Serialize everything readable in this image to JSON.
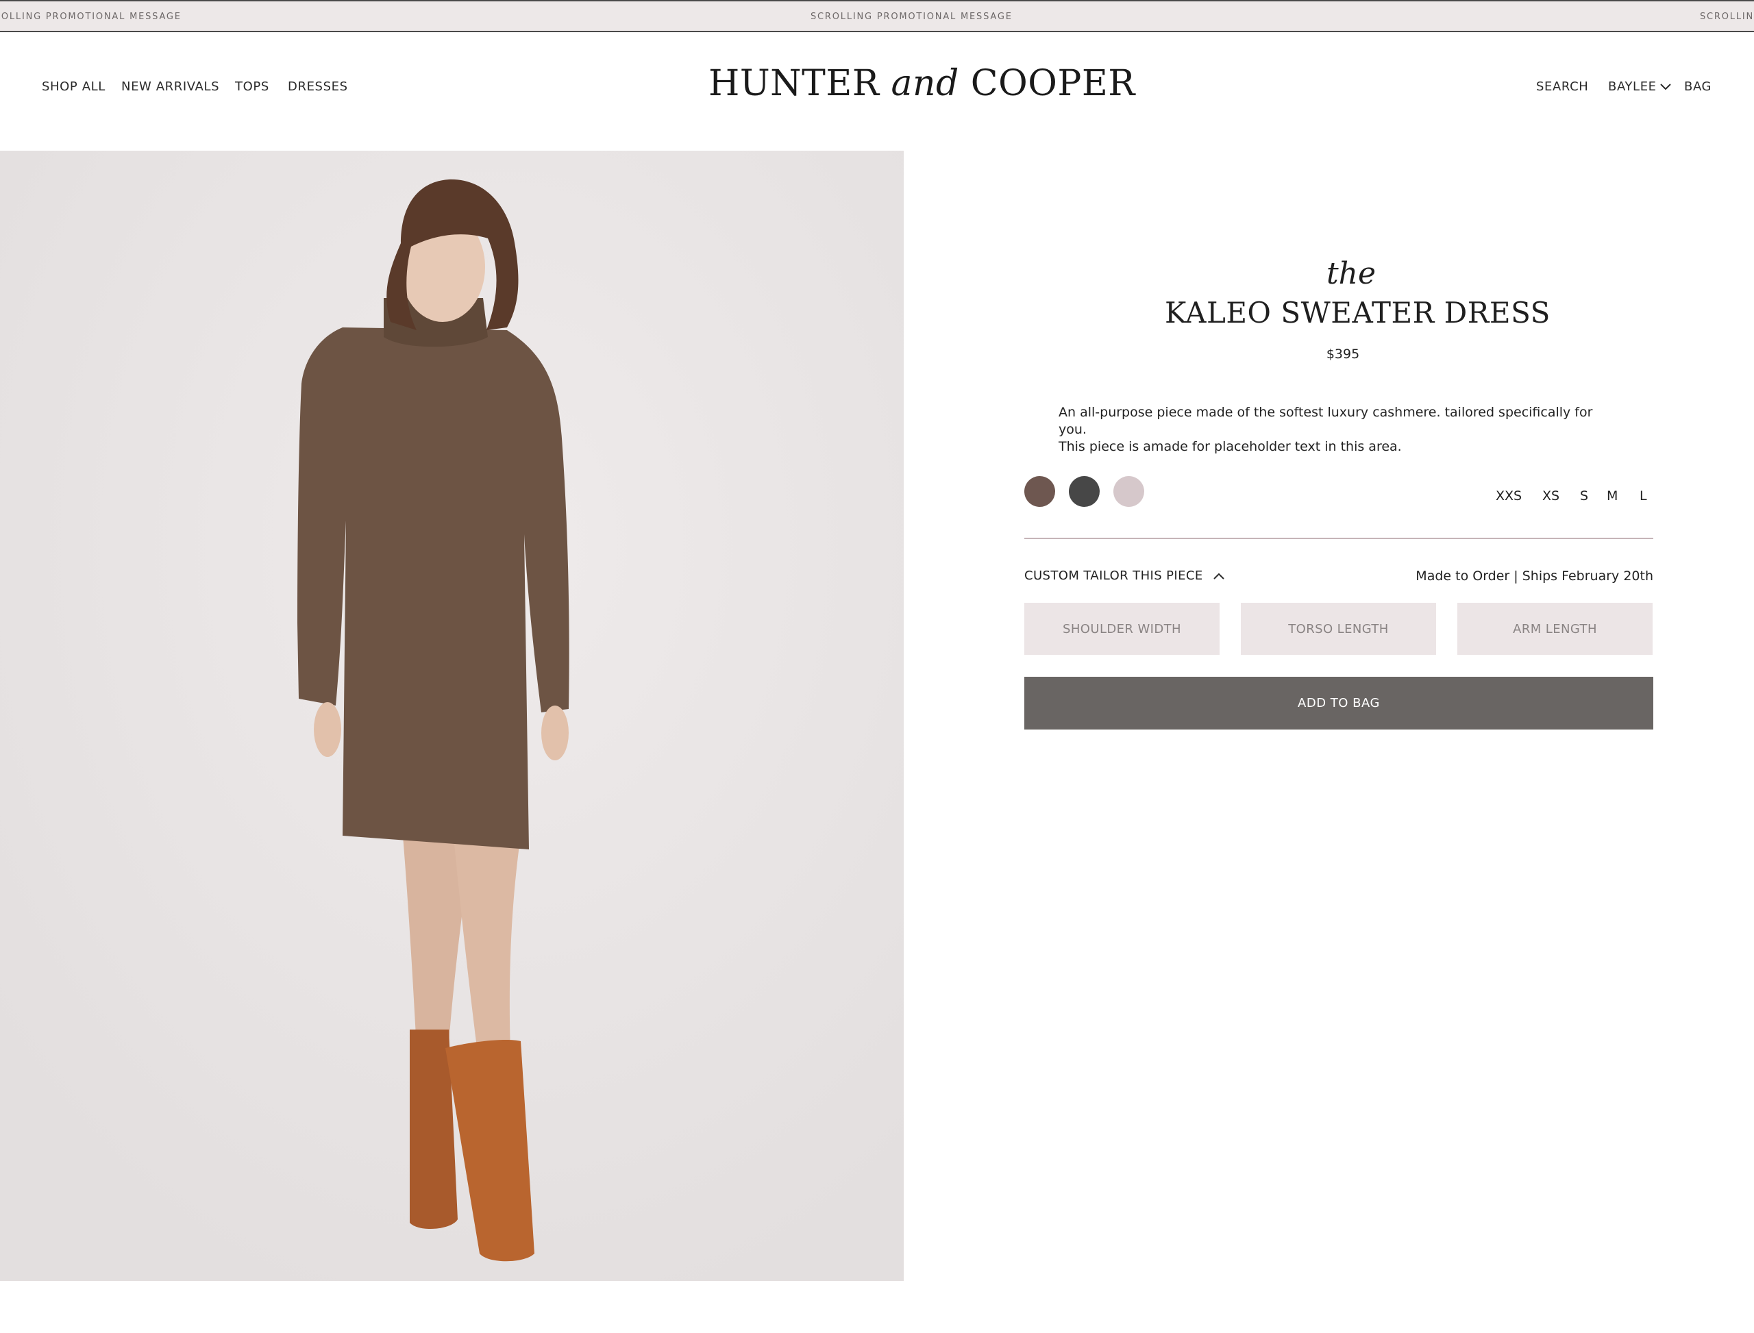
{
  "promo": {
    "message_left": "ROLLING PROMOTIONAL MESSAGE",
    "message_center": "SCROLLING PROMOTIONAL MESSAGE",
    "message_right": "SCROLLING"
  },
  "nav": {
    "left": [
      "SHOP ALL",
      "NEW ARRIVALS",
      "TOPS",
      "DRESSES"
    ],
    "right": {
      "search": "SEARCH",
      "account": "BAYLEE",
      "bag": "BAG"
    }
  },
  "logo": {
    "part1": "HUNTER ",
    "and": "and",
    "part2": " COOPER"
  },
  "product": {
    "prefix": "the",
    "name": "KALEO SWEATER DRESS",
    "price": "$395",
    "description_line1": "An all-purpose piece made of the softest luxury cashmere. tailored specifically for you.",
    "description_line2": "This piece is amade for placeholder text in this area.",
    "colors": [
      "#6e5750",
      "#474747",
      "#d6c8cb"
    ],
    "sizes": [
      "XXS",
      "XS",
      "S",
      "M",
      "L"
    ],
    "tailor_label": "CUSTOM TAILOR THIS PIECE",
    "shipping_note": "Made to Order | Ships February 20th",
    "measurements": [
      "SHOULDER WIDTH",
      "TORSO LENGTH",
      "ARM LENGTH"
    ],
    "add_to_bag": "ADD TO BAG"
  }
}
